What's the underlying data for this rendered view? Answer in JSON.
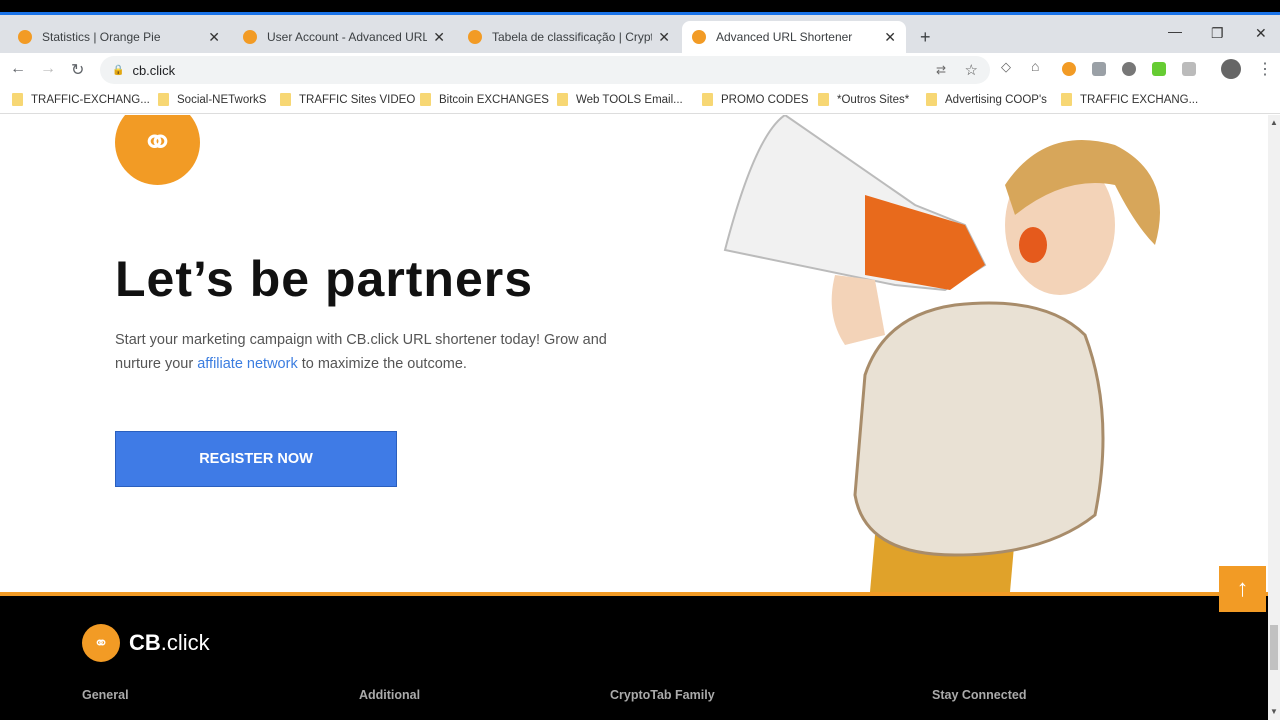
{
  "browser": {
    "tabs": [
      {
        "title": "Statistics | Orange Pie",
        "active": false
      },
      {
        "title": "User Account - Advanced URL Shortener",
        "active": false
      },
      {
        "title": "Tabela de classificação | CryptoTab",
        "active": false
      },
      {
        "title": "Advanced URL Shortener",
        "active": true
      }
    ],
    "new_tab": "+",
    "url": "cb.click",
    "bookmarks": [
      "TRAFFIC-EXCHANG...",
      "Social-NETworkS",
      "TRAFFIC Sites VIDEO",
      "Bitcoin EXCHANGES",
      "Web TOOLS Email...",
      "PROMO CODES",
      "*Outros Sites*",
      "Advertising COOP's",
      "TRAFFIC EXCHANG..."
    ]
  },
  "hero": {
    "title": "Let’s be partners",
    "desc_before": "Start your marketing campaign with CB.click URL shortener today! Grow and nurture your ",
    "desc_link": "affiliate network",
    "desc_after": " to maximize the outcome.",
    "button": "REGISTER NOW"
  },
  "footer": {
    "logo_bold": "CB",
    "logo_rest": ".click",
    "columns": [
      "General",
      "Additional",
      "CryptoTab Family",
      "Stay Connected"
    ]
  },
  "colors": {
    "accent": "#f29b25",
    "button": "#3f7be6",
    "link": "#3b7de0"
  }
}
